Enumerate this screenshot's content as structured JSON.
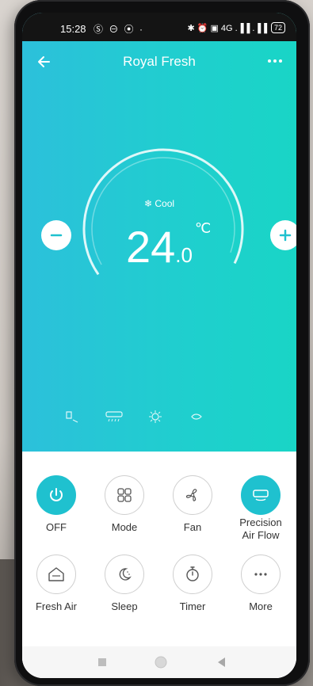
{
  "status": {
    "time": "15:28",
    "left_icons": "Ⓢ ⊖ ⦿ ·",
    "right_icons": "✱ ⏰ ▣ 4G .▐▐ .▐▐",
    "battery": "72"
  },
  "app": {
    "title": "Royal Fresh"
  },
  "ac": {
    "mode": "Cool",
    "temp_main": "24",
    "temp_decimal": ".0",
    "unit": "℃"
  },
  "controls": [
    {
      "label": "OFF",
      "active": true
    },
    {
      "label": "Mode",
      "active": false
    },
    {
      "label": "Fan",
      "active": false
    },
    {
      "label": "Precision\nAir Flow",
      "active": true
    },
    {
      "label": "Fresh Air",
      "active": false
    },
    {
      "label": "Sleep",
      "active": false
    },
    {
      "label": "Timer",
      "active": false
    },
    {
      "label": "More",
      "active": false
    }
  ],
  "colors": {
    "accent": "#1fc1cf",
    "hero_start": "#2cc0db",
    "hero_end": "#19d5c6"
  },
  "icons": [
    "back-arrow-icon",
    "more-horizontal-icon",
    "snowflake-icon",
    "minus-icon",
    "plus-icon",
    "power-icon",
    "grid-icon",
    "fan-icon",
    "aircon-icon",
    "house-icon",
    "moon-icon",
    "timer-icon",
    "dots-icon"
  ]
}
